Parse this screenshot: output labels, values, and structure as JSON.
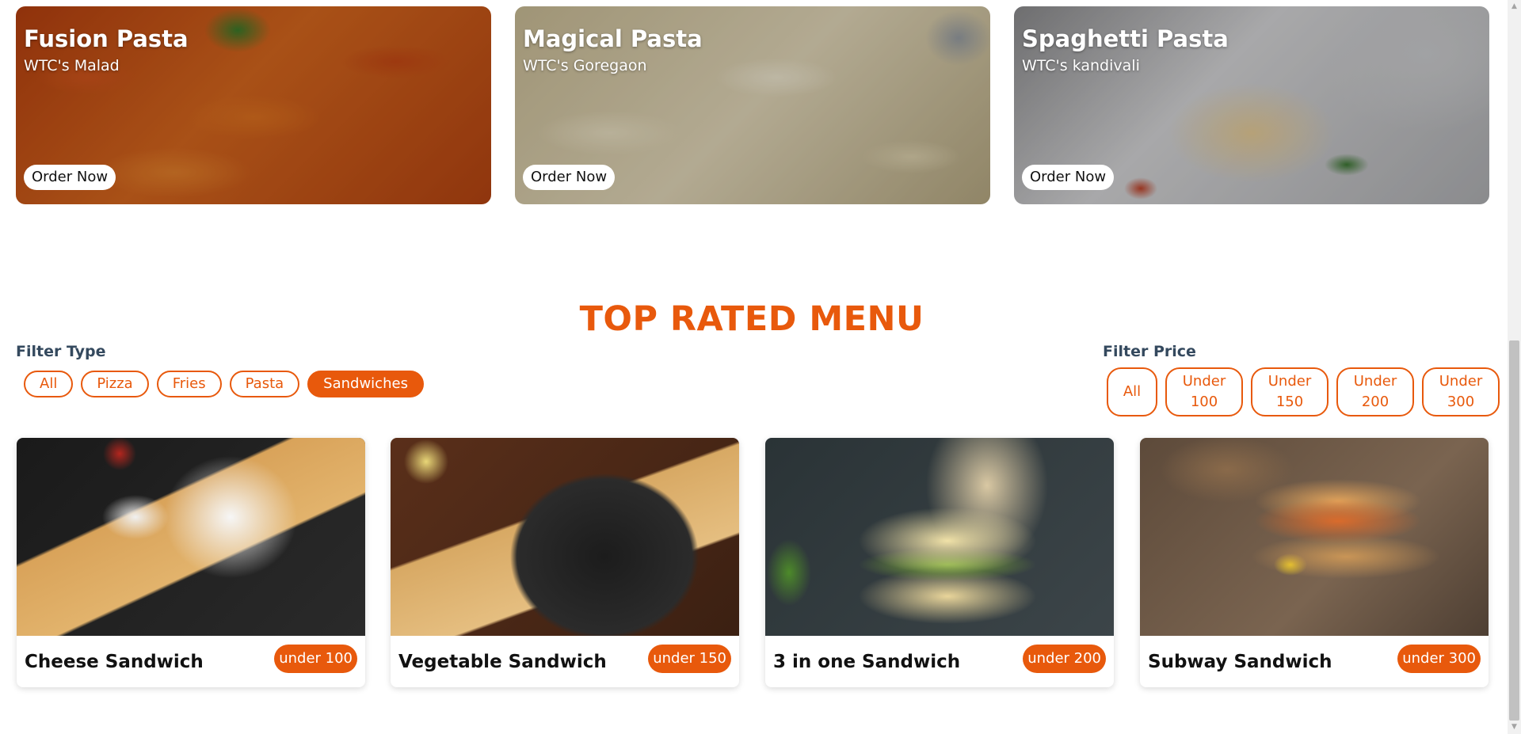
{
  "promos": [
    {
      "title": "Fusion Pasta",
      "location": "WTC's Malad",
      "cta": "Order Now"
    },
    {
      "title": "Magical Pasta",
      "location": "WTC's Goregaon",
      "cta": "Order Now"
    },
    {
      "title": "Spaghetti Pasta",
      "location": "WTC's kandivali",
      "cta": "Order Now"
    }
  ],
  "menu_section": {
    "title": "TOP RATED MENU",
    "filter_type": {
      "label": "Filter Type",
      "options": [
        "All",
        "Pizza",
        "Fries",
        "Pasta",
        "Sandwiches"
      ],
      "selected": "Sandwiches"
    },
    "filter_price": {
      "label": "Filter Price",
      "options": [
        "All",
        "Under 100",
        "Under 150",
        "Under 200",
        "Under 300"
      ]
    },
    "items": [
      {
        "name": "Cheese Sandwich",
        "price_badge": "under 100"
      },
      {
        "name": "Vegetable Sandwich",
        "price_badge": "under 150"
      },
      {
        "name": "3 in one Sandwich",
        "price_badge": "under 200"
      },
      {
        "name": "Subway Sandwich",
        "price_badge": "under 300"
      }
    ]
  },
  "colors": {
    "accent": "#e8590c",
    "label": "#34495e",
    "background": "#ffffff"
  }
}
